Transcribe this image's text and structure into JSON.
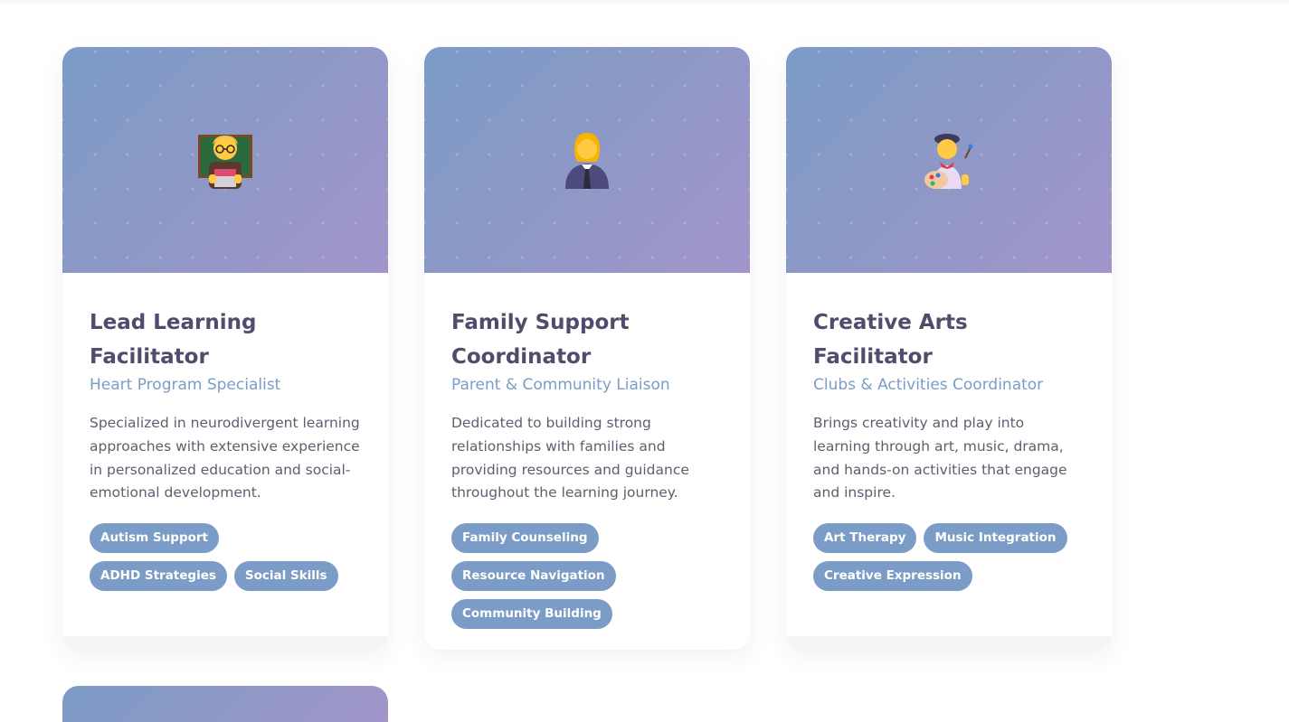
{
  "cards": [
    {
      "icon": "teacher-avatar-icon",
      "name": "Lead Learning Facilitator",
      "role": "Heart Program Specialist",
      "description": "Specialized in neurodivergent learning approaches with extensive experience in personalized education and social-emotional development.",
      "tags": [
        "Autism Support",
        "ADHD Strategies",
        "Social Skills"
      ]
    },
    {
      "icon": "office-worker-avatar-icon",
      "name": "Family Support Coordinator",
      "role": "Parent & Community Liaison",
      "description": "Dedicated to building strong relationships with families and providing resources and guidance throughout the learning journey.",
      "tags": [
        "Family Counseling",
        "Resource Navigation",
        "Community Building"
      ]
    },
    {
      "icon": "artist-avatar-icon",
      "name": "Creative Arts Facilitator",
      "role": "Clubs & Activities Coordinator",
      "description": "Brings creativity and play into learning through art, music, drama, and hands-on activities that engage and inspire.",
      "tags": [
        "Art Therapy",
        "Music Integration",
        "Creative Expression"
      ]
    }
  ],
  "colors": {
    "header_gradient_start": "#7b9cc6",
    "header_gradient_end": "#a295ca",
    "accent": "#7b9cc6",
    "title": "#4e4d6b"
  }
}
